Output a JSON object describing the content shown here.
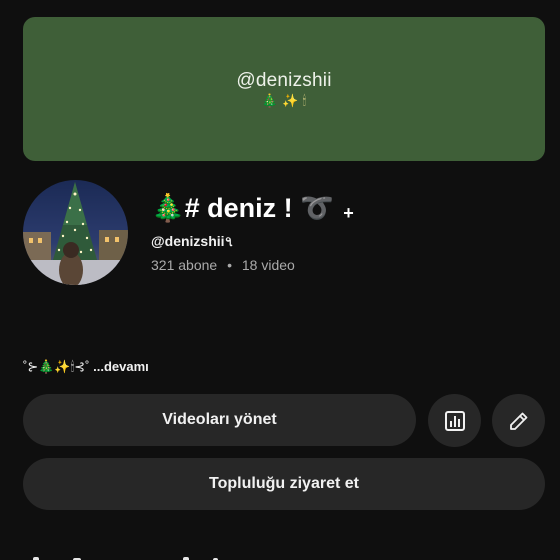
{
  "banner": {
    "handle": "@denizshii",
    "emoji": "🎄 ✨ 🕯"
  },
  "channel": {
    "name": "🎄# deniz ! ➰",
    "name_plus": "+",
    "handle": "@denizshii৭",
    "subscribers": "321 abone",
    "separator": "•",
    "videos": "18 video"
  },
  "description": {
    "text": "˚⊱🎄✨🕯⊰˚ ",
    "more": "...devamı"
  },
  "actions": {
    "manage_videos": "Videoları yönet",
    "visit_community": "Topluluğu ziyaret et",
    "analytics_icon": "bar-chart-icon",
    "edit_icon": "pencil-icon"
  },
  "colors": {
    "background": "#0f0f0f",
    "banner": "#3f5f38",
    "button": "#272727",
    "secondary_text": "#aaaaaa"
  }
}
